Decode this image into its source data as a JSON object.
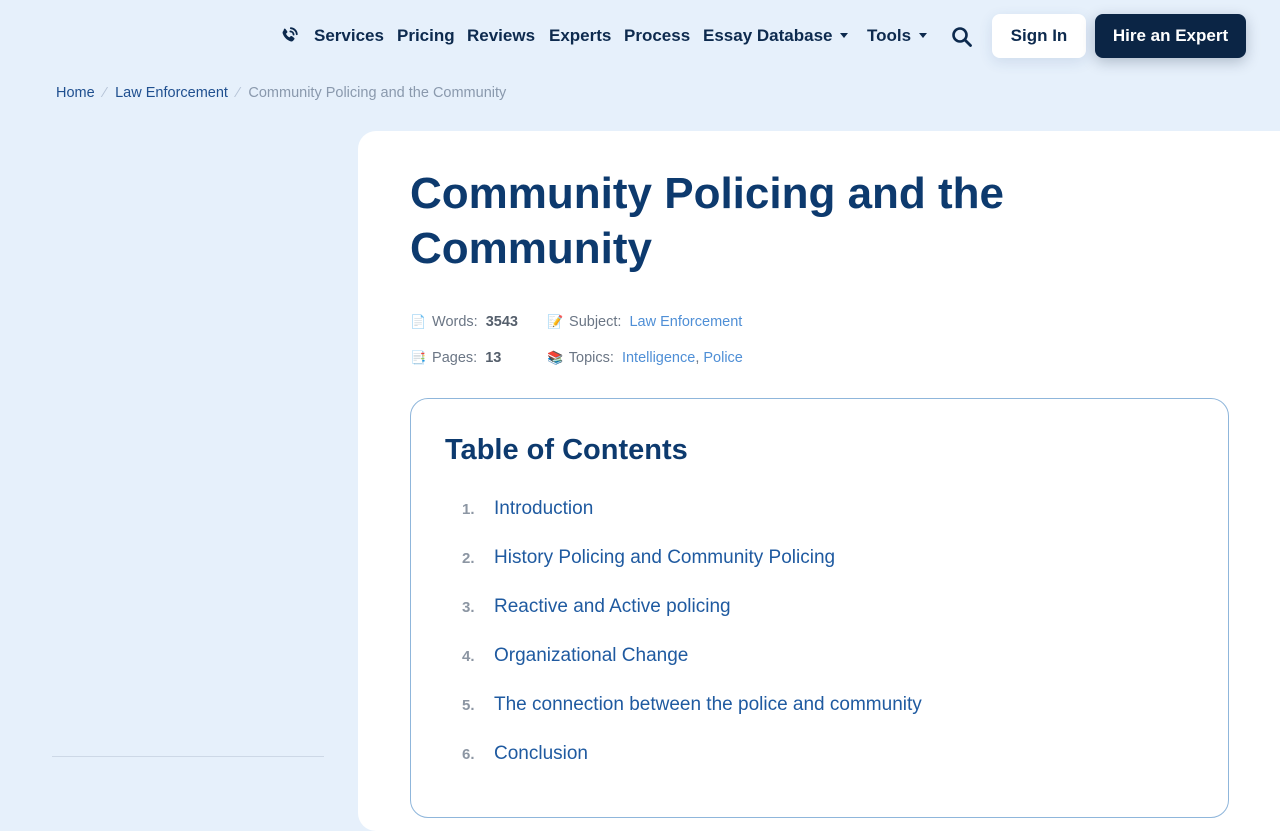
{
  "nav": {
    "items": [
      {
        "label": "Services"
      },
      {
        "label": "Pricing"
      },
      {
        "label": "Reviews"
      },
      {
        "label": "Experts"
      },
      {
        "label": "Process"
      },
      {
        "label": "Essay Database"
      },
      {
        "label": "Tools"
      }
    ],
    "sign_in": "Sign In",
    "hire": "Hire an Expert"
  },
  "breadcrumb": {
    "home": "Home",
    "category": "Law Enforcement",
    "current": "Community Policing and the Community"
  },
  "article": {
    "title": "Community Policing and the Community",
    "words_label": "Words:",
    "words": "3543",
    "pages_label": "Pages:",
    "pages": "13",
    "subject_label": "Subject:",
    "subject": "Law Enforcement",
    "topics_label": "Topics:",
    "topics": [
      "Intelligence",
      "Police"
    ],
    "topics_sep": ","
  },
  "toc": {
    "title": "Table of Contents",
    "items": [
      {
        "num": "1.",
        "label": "Introduction"
      },
      {
        "num": "2.",
        "label": "History Policing and Community Policing"
      },
      {
        "num": "3.",
        "label": "Reactive and Active policing"
      },
      {
        "num": "4.",
        "label": "Organizational Change"
      },
      {
        "num": "5.",
        "label": "The connection between the police and community"
      },
      {
        "num": "6.",
        "label": "Conclusion"
      }
    ]
  },
  "icons": {
    "phone": "phone-icon",
    "search": "search-icon",
    "words": "document-icon",
    "pages": "pages-icon",
    "subject": "memo-icon",
    "topics": "books-icon"
  },
  "colors": {
    "background": "#e6f0fb",
    "navy": "#0b2545",
    "title": "#0d3a6e",
    "link": "#1f5aa0",
    "toc_border": "#8fb6db"
  }
}
